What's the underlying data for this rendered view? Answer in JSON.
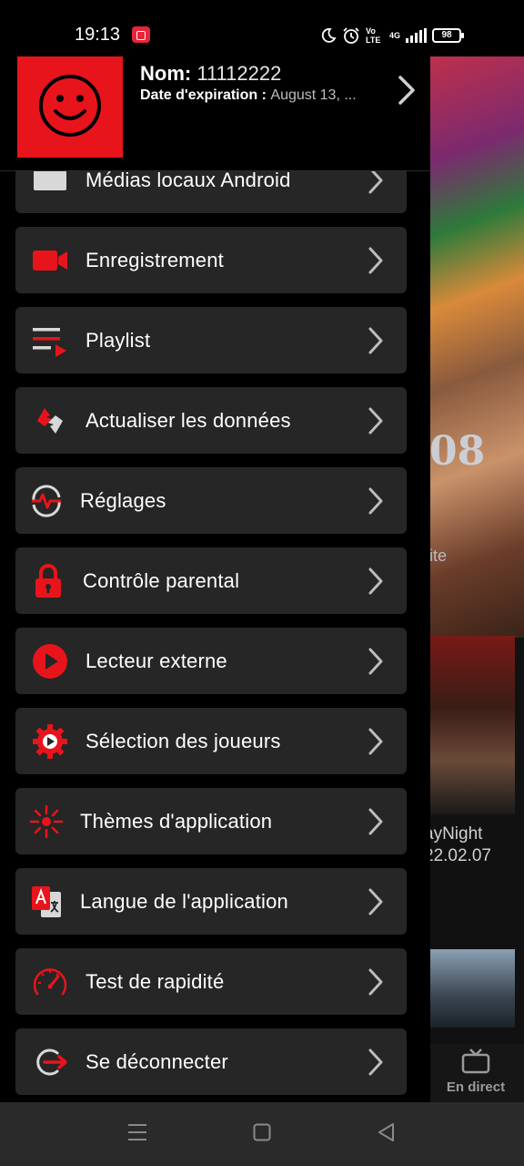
{
  "status_bar": {
    "time": "19:13",
    "volte": "Vo LTE",
    "network": "4G",
    "battery": "98"
  },
  "drawer": {
    "header": {
      "name_label": "Nom:",
      "name_value": "11112222",
      "expiry_label": "Date d'expiration :",
      "expiry_value": "August 13, ..."
    },
    "items": [
      {
        "label": "Médias locaux Android",
        "icon": "folder-icon"
      },
      {
        "label": "Enregistrement",
        "icon": "video-camera-icon"
      },
      {
        "label": "Playlist",
        "icon": "playlist-icon"
      },
      {
        "label": "Actualiser les données",
        "icon": "refresh-icon"
      },
      {
        "label": "Réglages",
        "icon": "settings-icon"
      },
      {
        "label": "Contrôle parental",
        "icon": "lock-icon"
      },
      {
        "label": "Lecteur externe",
        "icon": "play-circle-icon"
      },
      {
        "label": "Sélection des joueurs",
        "icon": "gear-play-icon"
      },
      {
        "label": "Thèmes d'application",
        "icon": "theme-icon"
      },
      {
        "label": "Langue de l'application",
        "icon": "translate-icon"
      },
      {
        "label": "Test de rapidité",
        "icon": "speedometer-icon"
      },
      {
        "label": "Se déconnecter",
        "icon": "logout-icon"
      }
    ]
  },
  "background": {
    "hero_text": "08",
    "hero_sub": "ite",
    "poster_title_1": "ayNight",
    "poster_title_2": "22.02.07",
    "tab_label": "En direct"
  },
  "colors": {
    "accent": "#e8141c",
    "item_bg": "#262626",
    "drawer_bg": "#000000"
  }
}
